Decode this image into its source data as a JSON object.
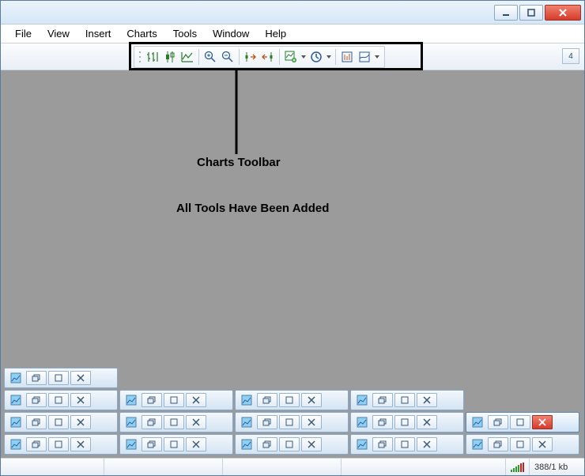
{
  "menu": {
    "file": "File",
    "view": "View",
    "insert": "Insert",
    "charts": "Charts",
    "tools": "Tools",
    "window": "Window",
    "help": "Help"
  },
  "toolbar": {
    "icons": {
      "bar": "bar-chart-icon",
      "candle": "candlestick-icon",
      "line": "line-chart-icon",
      "zoomin": "zoom-in-icon",
      "zoomout": "zoom-out-icon",
      "autoscroll": "auto-scroll-icon",
      "shift": "chart-shift-icon",
      "indicator": "indicators-icon",
      "period": "periodicity-icon",
      "template": "templates-icon",
      "grid": "grid-toggle-icon"
    },
    "badge": "4"
  },
  "annotation": {
    "title": "Charts Toolbar",
    "subtitle": "All Tools Have Been Added"
  },
  "status": {
    "traffic": "388/1 kb"
  },
  "titlebar": {
    "min": "minimize",
    "max": "maximize",
    "close": "close"
  },
  "mdi": {
    "icon": "chart-window-icon"
  }
}
